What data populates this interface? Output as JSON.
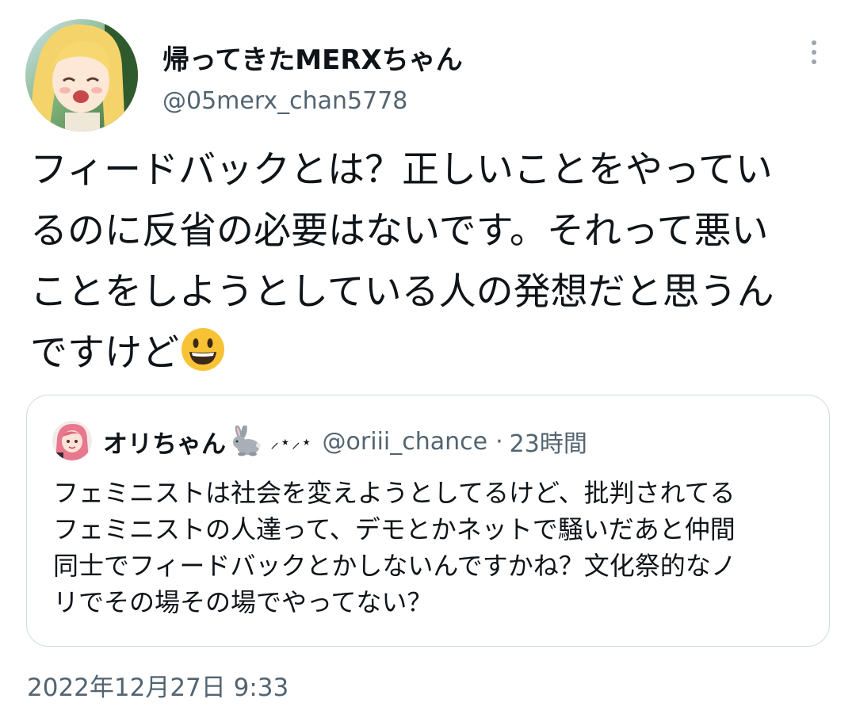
{
  "tweet": {
    "author": {
      "display_name": "帰ってきたMERXちゃん",
      "handle": "@05merx_chan5778"
    },
    "more_icon": "more-vertical-icon",
    "text_lines": [
      "フィードバックとは？正しいことをやってい",
      "るのに反省の必要はないです。それって悪い",
      "ことをしようとしている人の発想だと思うん",
      "ですけど"
    ],
    "trailing_emoji": "grinning-face-emoji",
    "timestamp": "2022年12月27日 9:33"
  },
  "quoted_tweet": {
    "display_name": "オリちゃん",
    "name_emoji": "rabbit-emoji",
    "decoration": "⸝⋆⸝⋆",
    "handle": "@oriii_chance",
    "separator": "·",
    "relative_time": "23時間",
    "text_lines": [
      "フェミニストは社会を変えようとしてるけど、批判されてる",
      "フェミニストの人達って、デモとかネットで騒いだあと仲間",
      "同士でフィードバックとかしないんですかね？文化祭的なノ",
      "リでその場その場でやってない？"
    ]
  },
  "colors": {
    "text_primary": "#0f1419",
    "text_secondary": "#536471",
    "card_border": "#cfd9de",
    "emoji_yellow": "#f7c234"
  }
}
